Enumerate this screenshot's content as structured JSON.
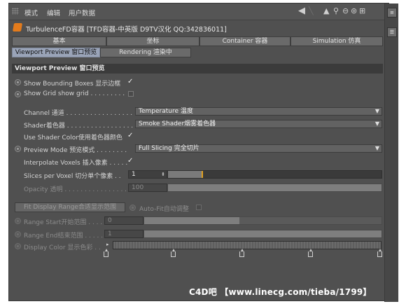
{
  "menubar": {
    "items": [
      "模式",
      "编辑",
      "用户数据"
    ],
    "icons": [
      "arrow-left-icon",
      "pointer-icon",
      "search-icon",
      "lock-icon",
      "target-icon",
      "new-panel-icon"
    ]
  },
  "object": {
    "title": "TurbulenceFD容器 [TFD容器-中英版 D9TV汉化 QQ:342836011]"
  },
  "tabs_row1": [
    "基本",
    "坐标",
    "Container 容器",
    "Simulation 仿真"
  ],
  "tabs_row2": [
    "Viewport Preview 窗口预览",
    "Rendering 渲染中"
  ],
  "active_tab": "Viewport Preview 窗口预览",
  "section": {
    "title": "Viewport Preview 窗口预览"
  },
  "options": {
    "bounding_boxes": {
      "label": "Show Bounding Boxes 显示边框",
      "checked": true
    },
    "grid": {
      "label": "Show Grid show grid . . . . . . . . .",
      "checked": false
    }
  },
  "channel": {
    "label": "Channel 通道 . . . . . . . . . . . . . . . . . .",
    "value": "Temperature 温度"
  },
  "shader": {
    "label": "Shader着色器 . . . . . . . . . . . . . . . . .",
    "value": "Smoke Shader烟雾着色器"
  },
  "use_shader_color": {
    "label": "Use Shader Color使用着色器颜色",
    "checked": true
  },
  "preview_mode": {
    "label": "Preview Mode 预览模式 . . . . . . . .",
    "value": "Full Slicing 完全切片"
  },
  "interpolate": {
    "label": "Interpolate Voxels 插入像素 . . . . .",
    "checked": true
  },
  "slices": {
    "label": "Slices per Voxel 切分单个像素 . .",
    "value": "1",
    "slider_fraction": 0.16
  },
  "opacity": {
    "label": "Opacity 透明 . . . . . . . . . . . . . . . . .",
    "value": "100",
    "slider_fraction": 1.0
  },
  "fit_button": {
    "label": "Fit Display Range合适显示范围"
  },
  "auto_fit": {
    "label": "Auto-Fit自动调整",
    "checked": false
  },
  "range_start": {
    "label": "Range Start开始范围 . . . . .",
    "value": "0",
    "slider_fraction": 0.4
  },
  "range_end": {
    "label": "Range End结束范围 . . . . . .",
    "value": "1",
    "slider_fraction": 1.0
  },
  "display_color": {
    "label": "Display Color 显示色彩 . ."
  },
  "watermark": "C4D吧 【www.linecg.com/tieba/1799】",
  "colors": {
    "panel": "#505050",
    "active_tab": "#9aa4b8",
    "accent": "#e0a020",
    "object_icon": "#e37b1c"
  }
}
